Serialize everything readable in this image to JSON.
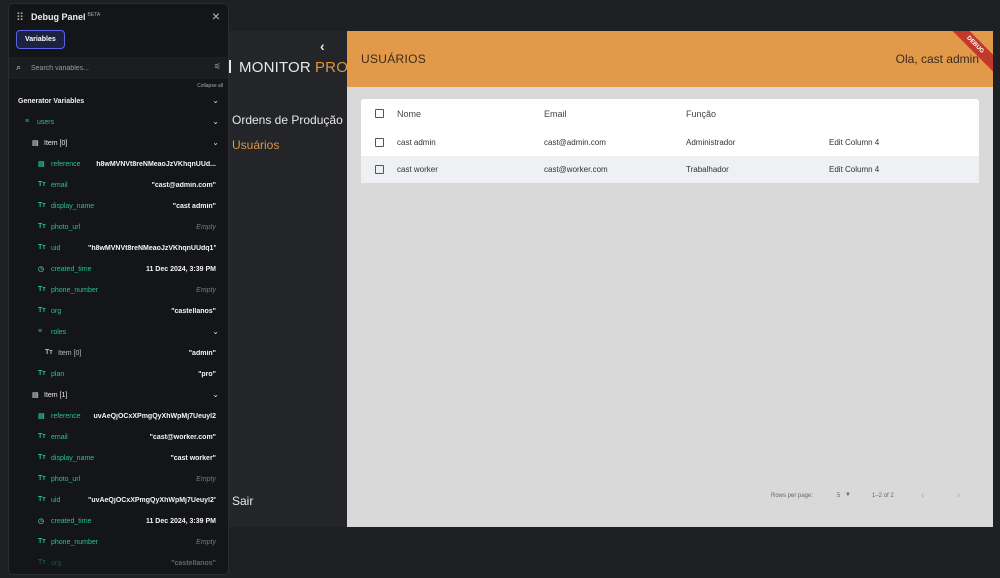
{
  "app": {
    "brand": "MONITOR",
    "brand_suffix": "PRO",
    "nav": {
      "ordens": "Ordens de Produção",
      "usuarios": "Usuários",
      "sair": "Sair"
    }
  },
  "main": {
    "title": "USUÁRIOS",
    "greeting": "Ola, cast admin",
    "ribbon": "DEBUG",
    "columns": [
      "Nome",
      "Email",
      "Função"
    ],
    "rows": [
      {
        "nome": "cast admin",
        "email": "cast@admin.com",
        "funcao": "Administrador",
        "col4": "Edit Column 4"
      },
      {
        "nome": "cast worker",
        "email": "cast@worker.com",
        "funcao": "Trabalhador",
        "col4": "Edit Column 4"
      }
    ],
    "pager": {
      "rows_label": "Rows per page:",
      "rows_value": "5",
      "range": "1–2 of 2"
    }
  },
  "debug": {
    "title": "Debug Panel",
    "beta": "BETA",
    "tab": "Variables",
    "search_placeholder": "Search variables...",
    "collapse_all": "Collapse all",
    "group": "Generator Variables",
    "users": "users",
    "item0": {
      "label": "Item [0]",
      "reference": "h8wMVNVt8reNMeaoJzVKhqnUUd...",
      "email": "\"cast@admin.com\"",
      "display_name": "\"cast admin\"",
      "photo_url": "Empty",
      "uid": "\"h8wMVNVt8reNMeaoJzVKhqnUUdq1\"",
      "created_time": "11 Dec 2024, 3:39 PM",
      "phone_number": "Empty",
      "org": "\"castellanos\"",
      "roles_item_label": "Item [0]",
      "roles_item": "\"admin\"",
      "plan": "\"pro\""
    },
    "item1": {
      "label": "Item [1]",
      "reference": "uvAeQjOCxXPmgQyXhWpMj7Ueuyl2",
      "email": "\"cast@worker.com\"",
      "display_name": "\"cast worker\"",
      "photo_url": "Empty",
      "uid": "\"uvAeQjOCxXPmgQyXhWpMj7Ueuyl2\"",
      "created_time": "11 Dec 2024, 3:39 PM",
      "phone_number": "Empty",
      "org": "\"castellanos\""
    },
    "keys": {
      "reference": "reference",
      "email": "email",
      "display_name": "display_name",
      "photo_url": "photo_url",
      "uid": "uid",
      "created_time": "created_time",
      "phone_number": "phone_number",
      "org": "org",
      "roles": "roles",
      "plan": "plan"
    }
  }
}
